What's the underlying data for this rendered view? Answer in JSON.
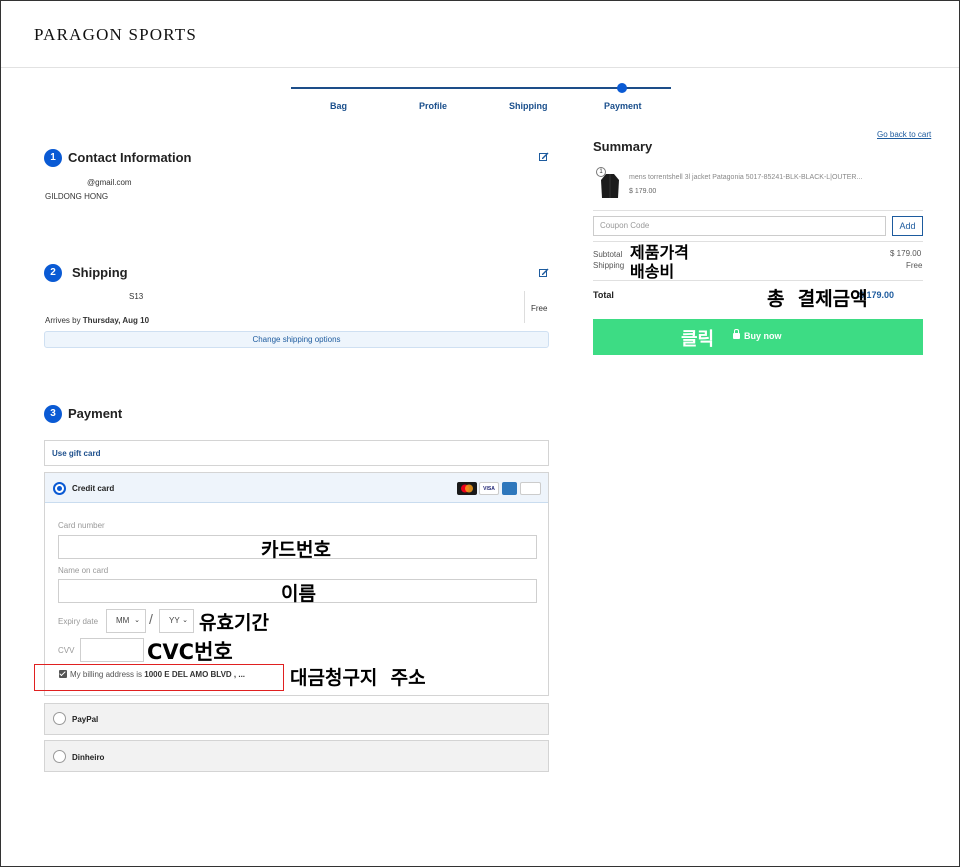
{
  "brand": {
    "logo": "PARAGON SPORTS"
  },
  "stepper": {
    "steps": [
      "Bag",
      "Profile",
      "Shipping",
      "Payment"
    ],
    "active": "Payment"
  },
  "contact": {
    "number": "1",
    "title": "Contact Information",
    "email": "@gmail.com",
    "name": "GILDONG HONG"
  },
  "shipping": {
    "number": "2",
    "title": "Shipping",
    "address": "S13",
    "arrives_prefix": "Arrives by",
    "arrives_date": "Thursday, Aug 10",
    "price": "Free",
    "change_label": "Change shipping options"
  },
  "payment": {
    "number": "3",
    "title": "Payment",
    "gift_card": "Use gift card",
    "credit_card": "Credit card",
    "card_logos": [
      "MasterCard",
      "VISA",
      "AMEX",
      "DISCOVER"
    ],
    "card_number_label": "Card number",
    "name_on_card_label": "Name on card",
    "expiry_label": "Expiry date",
    "month_value": "MM",
    "year_value": "YY",
    "slash": "/",
    "cvv_label": "CVV",
    "billing_prefix": "My billing address is",
    "billing_address": "1000 E DEL AMO BLVD , ...",
    "paypal": "PayPal",
    "dinheiro": "Dinheiro"
  },
  "annotations": {
    "card_number": "카드번호",
    "name": "이름",
    "expiry": "유효기간",
    "cvc": "CVC번호",
    "billing": "대금청구지  주소",
    "product_price": "제품가격",
    "shipping_fee": "배송비",
    "total": "총  결제금액",
    "click": "클릭"
  },
  "summary": {
    "title": "Summary",
    "back_link": "Go back to cart",
    "qty": "1",
    "product_name": "mens torrentshell 3l jacket Patagonia 5017-85241-BLK-BLACK-L|OUTER...",
    "product_price": "$ 179.00",
    "coupon_placeholder": "Coupon Code",
    "add_label": "Add",
    "subtotal_label": "Subtotal",
    "subtotal_value": "$ 179.00",
    "shipping_label": "Shipping",
    "shipping_value": "Free",
    "total_label": "Total",
    "total_value": "$ 179.00",
    "buy_label": "Buy now"
  },
  "colors": {
    "accent": "#0a5ad4",
    "link": "#1d5b9e",
    "buy": "#3ddc84",
    "highlight_border": "#e02020"
  }
}
